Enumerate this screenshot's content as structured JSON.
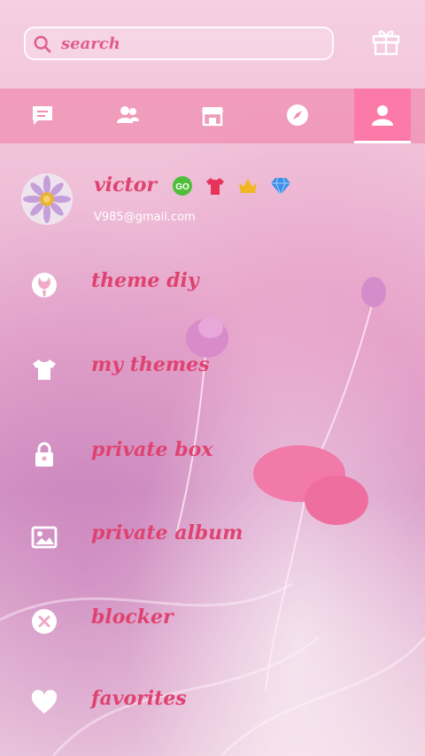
{
  "search": {
    "placeholder": "search"
  },
  "tabs": [
    {
      "name": "messages",
      "icon": "chat-icon",
      "active": false
    },
    {
      "name": "contacts",
      "icon": "contacts-icon",
      "active": false
    },
    {
      "name": "store",
      "icon": "store-icon",
      "active": false
    },
    {
      "name": "discover",
      "icon": "compass-icon",
      "active": false
    },
    {
      "name": "profile",
      "icon": "person-icon",
      "active": true
    }
  ],
  "profile": {
    "name": "victor",
    "email": "V985@gmail.com",
    "badges": [
      "go-badge-icon",
      "tshirt-badge-icon",
      "crown-badge-icon",
      "diamond-badge-icon"
    ]
  },
  "menu": [
    {
      "label": "theme diy",
      "icon": "palette-icon"
    },
    {
      "label": "my themes",
      "icon": "tshirt-icon"
    },
    {
      "label": "private box",
      "icon": "lock-icon"
    },
    {
      "label": "private album",
      "icon": "album-icon"
    },
    {
      "label": "blocker",
      "icon": "block-icon"
    },
    {
      "label": "favorites",
      "icon": "heart-icon"
    }
  ],
  "colors": {
    "accent": "#e0426f",
    "tab_bar": "#f08caf",
    "tab_active": "#fc78a5"
  }
}
